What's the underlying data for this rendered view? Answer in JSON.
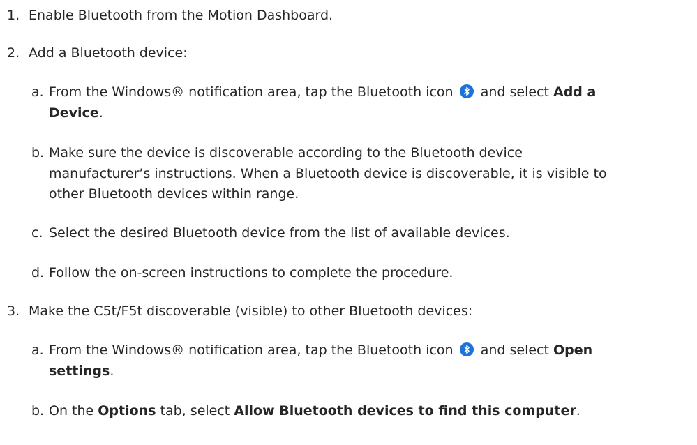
{
  "steps": [
    {
      "num": "1.",
      "text": "Enable Bluetooth from the Motion Dashboard."
    },
    {
      "num": "2.",
      "text": "Add a Bluetooth device:",
      "substeps": [
        {
          "letter": "a.",
          "pre": "From the Windows® notification area, tap the Bluetooth icon",
          "mid": "and select",
          "bold1": "Add a",
          "bold2": "Device",
          "post": "."
        },
        {
          "letter": "b.",
          "line1": "Make sure the device is discoverable according to the Bluetooth device",
          "line2": "manufacturer’s instructions. When a Bluetooth device is discoverable, it is visible to",
          "line3": "other Bluetooth devices within range."
        },
        {
          "letter": "c.",
          "text": "Select the desired Bluetooth device from the list of available devices."
        },
        {
          "letter": "d.",
          "text": "Follow the on-screen instructions to complete the procedure."
        }
      ]
    },
    {
      "num": "3.",
      "text": "Make the C5t/F5t discoverable (visible) to other Bluetooth devices:",
      "substeps": [
        {
          "letter": "a.",
          "pre": "From the Windows® notification area, tap the Bluetooth icon",
          "mid": "and select",
          "bold1": "Open",
          "bold2": "settings",
          "post": "."
        },
        {
          "letter": "b.",
          "pre": "On the",
          "bold1": "Options",
          "mid": "tab, select",
          "bold2": "Allow Bluetooth devices to find this computer",
          "post": "."
        }
      ]
    }
  ],
  "icons": {
    "bluetooth": "bluetooth-icon",
    "color": "#1e73d8"
  }
}
